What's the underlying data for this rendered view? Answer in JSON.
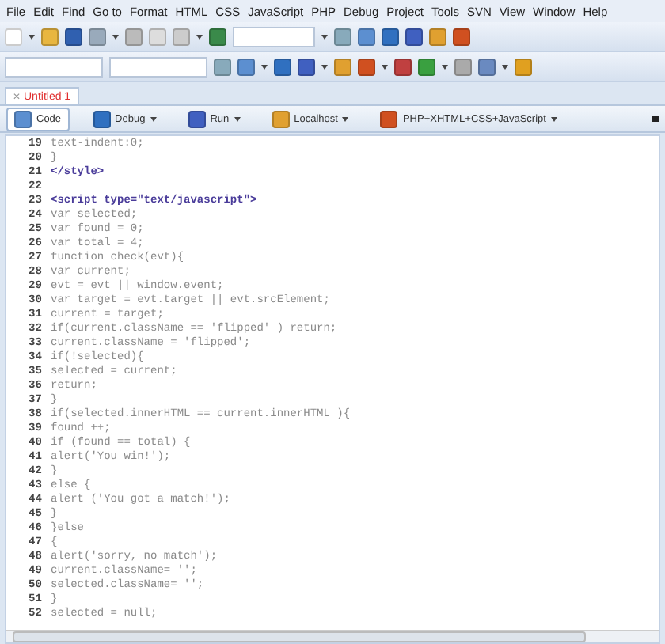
{
  "menu_bar": [
    "File",
    "Edit",
    "Find",
    "Go to",
    "Format",
    "HTML",
    "CSS",
    "JavaScript",
    "PHP",
    "Debug",
    "Project",
    "Tools",
    "SVN",
    "View",
    "Window",
    "Help"
  ],
  "tabs": [
    {
      "label": "Untitled 1",
      "selected": true,
      "close": "✕"
    }
  ],
  "view_toolbar": [
    {
      "label": "Code",
      "selected": true,
      "dropdown": false
    },
    {
      "label": "Debug",
      "selected": false,
      "dropdown": true
    },
    {
      "label": "Run",
      "selected": false,
      "dropdown": true
    },
    {
      "label": "Localhost",
      "selected": false,
      "dropdown": true
    },
    {
      "label": "PHP+XHTML+CSS+JavaScript",
      "selected": false,
      "dropdown": true
    }
  ],
  "editor": {
    "lines": [
      {
        "number": "19",
        "text": "text-indent:0;",
        "kind": "code"
      },
      {
        "number": "20",
        "text": "}",
        "kind": "code"
      },
      {
        "number": "21",
        "text": "</style>",
        "kind": "tag"
      },
      {
        "number": "22"
      },
      {
        "number": "23",
        "text": "<script type=\"text/javascript\">",
        "kind": "tag"
      },
      {
        "number": "24",
        "text": "var selected;",
        "kind": "code"
      },
      {
        "number": "25",
        "text": "var found = 0;",
        "kind": "code"
      },
      {
        "number": "26",
        "text": "var total = 4;",
        "kind": "code"
      },
      {
        "number": "27",
        "text": "function check(evt){",
        "kind": "code"
      },
      {
        "number": "28",
        "text": "var current;",
        "kind": "code"
      },
      {
        "number": "29",
        "text": "evt = evt || window.event;",
        "kind": "code"
      },
      {
        "number": "30",
        "text": "var target = evt.target || evt.srcElement;",
        "kind": "code"
      },
      {
        "number": "31",
        "text": "current = target;",
        "kind": "code"
      },
      {
        "number": "32",
        "text": "if(current.className == 'flipped' ) return;",
        "kind": "code"
      },
      {
        "number": "33",
        "text": "current.className = 'flipped';",
        "kind": "code"
      },
      {
        "number": "34",
        "text": "if(!selected){",
        "kind": "code"
      },
      {
        "number": "35",
        "text": "selected = current;",
        "kind": "code"
      },
      {
        "number": "36",
        "text": "return;",
        "kind": "code"
      },
      {
        "number": "37",
        "text": "}",
        "kind": "code"
      },
      {
        "number": "38",
        "text": "if(selected.innerHTML == current.innerHTML ){",
        "kind": "code"
      },
      {
        "number": "39",
        "text": "found ++;",
        "kind": "code"
      },
      {
        "number": "40",
        "text": "if (found == total) {",
        "kind": "code"
      },
      {
        "number": "41",
        "text": "alert('You win!');",
        "kind": "code"
      },
      {
        "number": "42",
        "text": "}",
        "kind": "code"
      },
      {
        "number": "43",
        "text": "else {",
        "kind": "code"
      },
      {
        "number": "44",
        "text": "alert ('You got a match!');",
        "kind": "code"
      },
      {
        "number": "45",
        "text": "}",
        "kind": "code"
      },
      {
        "number": "46",
        "text": "}else",
        "kind": "code"
      },
      {
        "number": "47",
        "text": "{",
        "kind": "code"
      },
      {
        "number": "48",
        "text": "alert('sorry, no match');",
        "kind": "code"
      },
      {
        "number": "49",
        "text": "current.className= '';",
        "kind": "code"
      },
      {
        "number": "50",
        "text": "selected.className= '';",
        "kind": "code"
      },
      {
        "number": "51",
        "text": "}",
        "kind": "code"
      },
      {
        "number": "52",
        "text": "selected = null;",
        "kind": "code"
      }
    ]
  }
}
